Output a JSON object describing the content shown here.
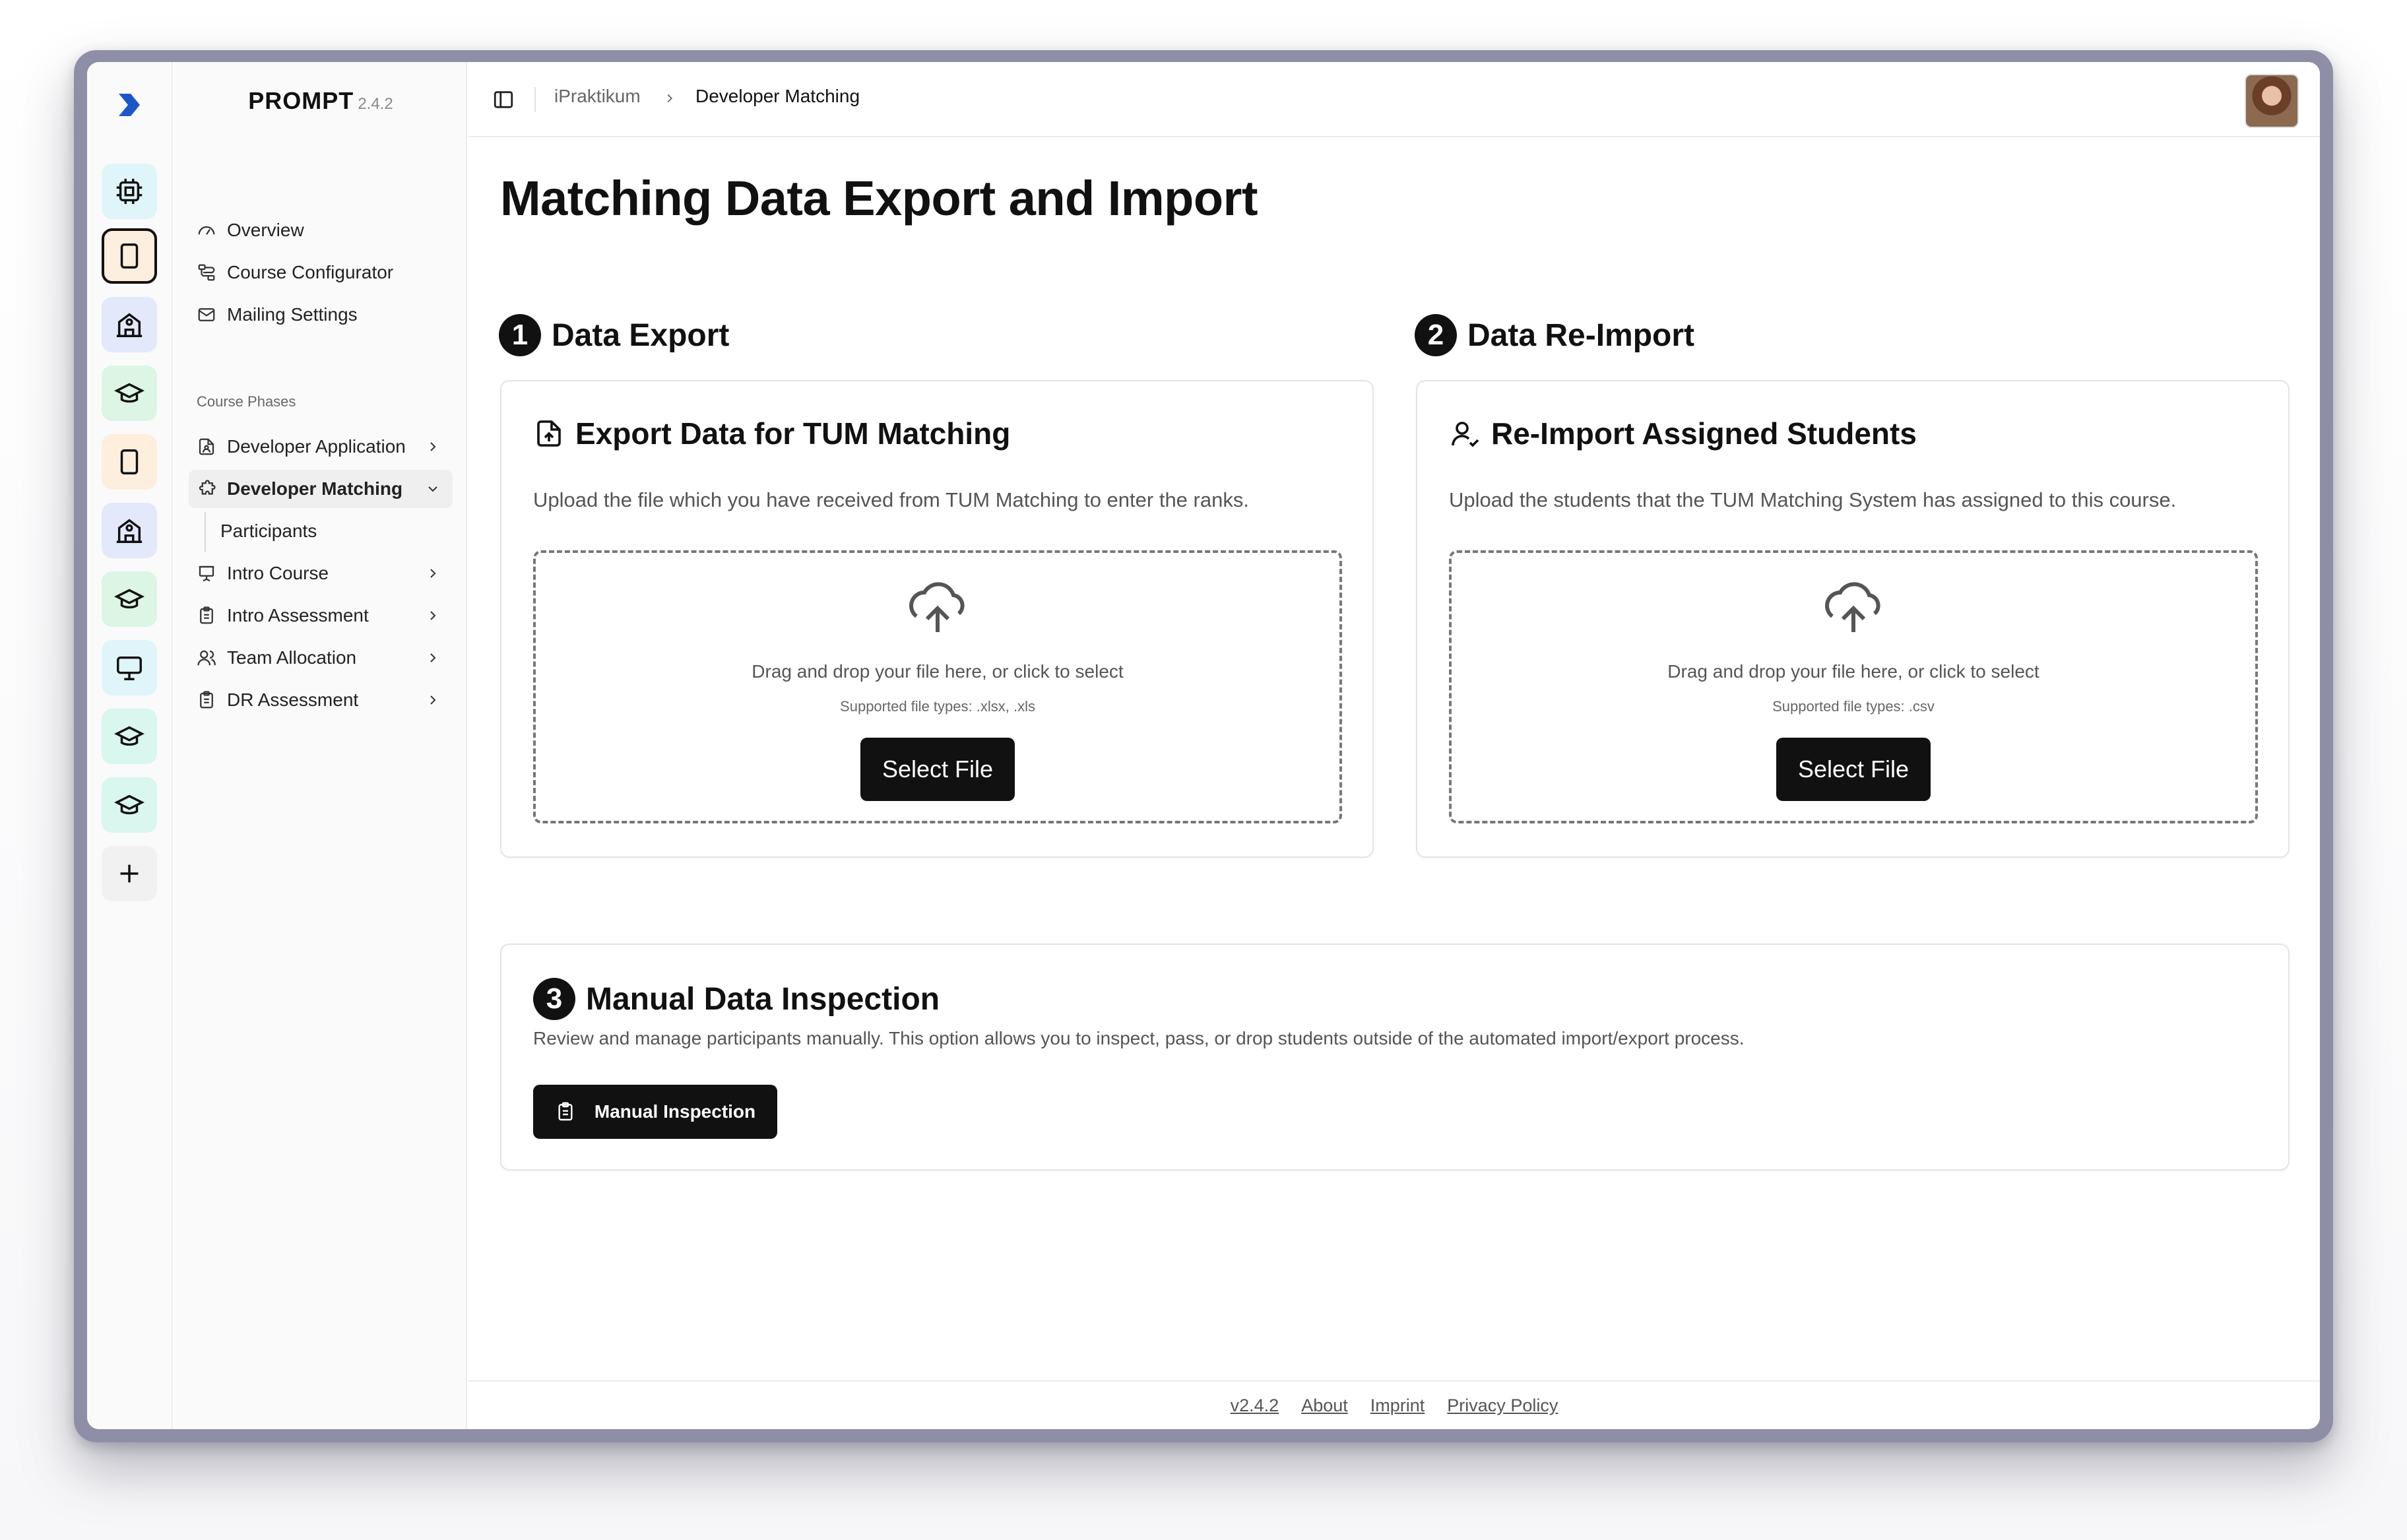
{
  "app": {
    "name": "PROMPT",
    "version": "2.4.2"
  },
  "rail": {
    "items": [
      {
        "icon": "cpu-icon",
        "bg": "#dff5f9"
      },
      {
        "icon": "tablet-icon",
        "bg": "#fdeedd",
        "active": true
      },
      {
        "icon": "school-icon",
        "bg": "#e4e8fb"
      },
      {
        "icon": "graduation-cap-icon",
        "bg": "#dcf5e4"
      },
      {
        "icon": "tablet-icon",
        "bg": "#fdeedd"
      },
      {
        "icon": "school-icon",
        "bg": "#e4e8fb"
      },
      {
        "icon": "graduation-cap-icon",
        "bg": "#dcf5e4"
      },
      {
        "icon": "monitor-icon",
        "bg": "#dff5f9"
      },
      {
        "icon": "graduation-cap-icon",
        "bg": "#d9f6ef"
      },
      {
        "icon": "graduation-cap-icon",
        "bg": "#d9f6ef"
      },
      {
        "icon": "plus-icon",
        "bg": "#f1f1f1"
      }
    ]
  },
  "sidebar": {
    "top_items": [
      {
        "label": "Overview",
        "icon": "gauge-icon"
      },
      {
        "label": "Course Configurator",
        "icon": "workflow-icon"
      },
      {
        "label": "Mailing Settings",
        "icon": "mail-icon"
      }
    ],
    "section_label": "Course Phases",
    "phase_items": [
      {
        "label": "Developer Application",
        "icon": "file-user-icon"
      },
      {
        "label": "Developer Matching",
        "icon": "puzzle-icon",
        "active": true
      },
      {
        "label": "Participants",
        "icon": ""
      },
      {
        "label": "Intro Course",
        "icon": "presentation-icon"
      },
      {
        "label": "Intro Assessment",
        "icon": "clipboard-icon"
      },
      {
        "label": "Team Allocation",
        "icon": "users-icon"
      },
      {
        "label": "DR Assessment",
        "icon": "clipboard-icon"
      }
    ]
  },
  "breadcrumb": {
    "parent": "iPraktikum",
    "current": "Developer Matching"
  },
  "page": {
    "title": "Matching Data Export and Import"
  },
  "export": {
    "step": "1",
    "step_title": "Data Export",
    "card_title": "Export Data for TUM Matching",
    "description": "Upload the file which you have received from TUM Matching to enter the ranks.",
    "drop_text": "Drag and drop your file here, or click to select",
    "file_types": "Supported file types: .xlsx, .xls",
    "button": "Select File"
  },
  "reimport": {
    "step": "2",
    "step_title": "Data Re-Import",
    "card_title": "Re-Import Assigned Students",
    "description": "Upload the students that the TUM Matching System has assigned to this course.",
    "drop_text": "Drag and drop your file here, or click to select",
    "file_types": "Supported file types: .csv",
    "button": "Select File"
  },
  "inspection": {
    "step": "3",
    "title": "Manual Data Inspection",
    "description": "Review and manage participants manually. This option allows you to inspect, pass, or drop students outside of the automated import/export process.",
    "button": "Manual Inspection"
  },
  "footer": {
    "version": "v2.4.2",
    "about": "About",
    "imprint": "Imprint",
    "privacy": "Privacy Policy"
  },
  "colors": {
    "accent": "#1f56c7",
    "primary_button": "#111111"
  }
}
